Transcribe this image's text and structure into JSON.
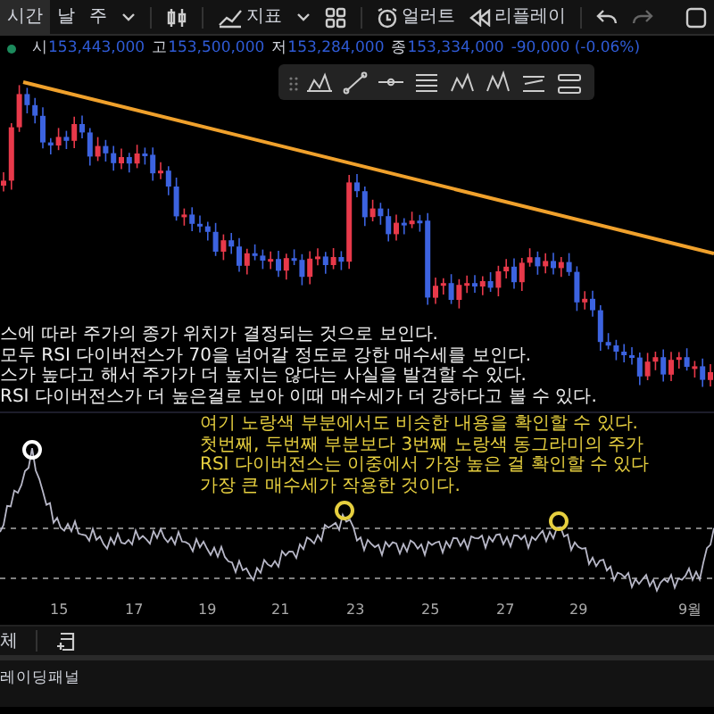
{
  "toolbar": {
    "items": [
      {
        "kind": "text",
        "label": "시간",
        "selected": true
      },
      {
        "kind": "text",
        "label": "날",
        "selected": false
      },
      {
        "kind": "text",
        "label": "주",
        "selected": false
      },
      {
        "kind": "caret"
      },
      {
        "kind": "candles"
      },
      {
        "kind": "indicator",
        "label": "지표"
      },
      {
        "kind": "caret"
      },
      {
        "kind": "grid"
      },
      {
        "kind": "alert",
        "label": "얼러트"
      },
      {
        "kind": "replay",
        "label": "리플레이"
      },
      {
        "kind": "undo"
      },
      {
        "kind": "redo"
      },
      {
        "kind": "square"
      }
    ]
  },
  "ohlc": [
    {
      "label": "시",
      "value": "153,443,000"
    },
    {
      "label": "고",
      "value": "153,500,000"
    },
    {
      "label": "저",
      "value": "153,284,000"
    },
    {
      "label": "종",
      "value": "153,334,000"
    }
  ],
  "change": "-90,000 (-0.06%)",
  "note_white": [
    "스에 따라 주가의 종가 위치가 결정되는 것으로 보인다.",
    "모두 RSI 다이버전스가 70을 넘어갈 정도로 강한 매수세를 보인다.",
    "스가 높다고 해서 주가가 더 높지는 않다는 사실을 발견할 수 있다.",
    "RSI 다이버전스가 더 높은걸로 보아 이때 매수세가 더 강하다고 볼 수 있다."
  ],
  "note_yellow": [
    "여기 노랑색 부분에서도 비슷한 내용을 확인할 수 있다.",
    "첫번째, 두번째 부분보다 3번째 노랑색 동그라미의 주가",
    "RSI 다이버전스는 이중에서 가장 높은 걸 확인할 수 있다",
    "가장 큰 매수세가 작용한 것이다."
  ],
  "x_axis": [
    "15",
    "17",
    "19",
    "21",
    "23",
    "25",
    "27",
    "29",
    "9월"
  ],
  "bottom_bar": {
    "label": "체"
  },
  "panel_tab": "레이딩패널"
}
